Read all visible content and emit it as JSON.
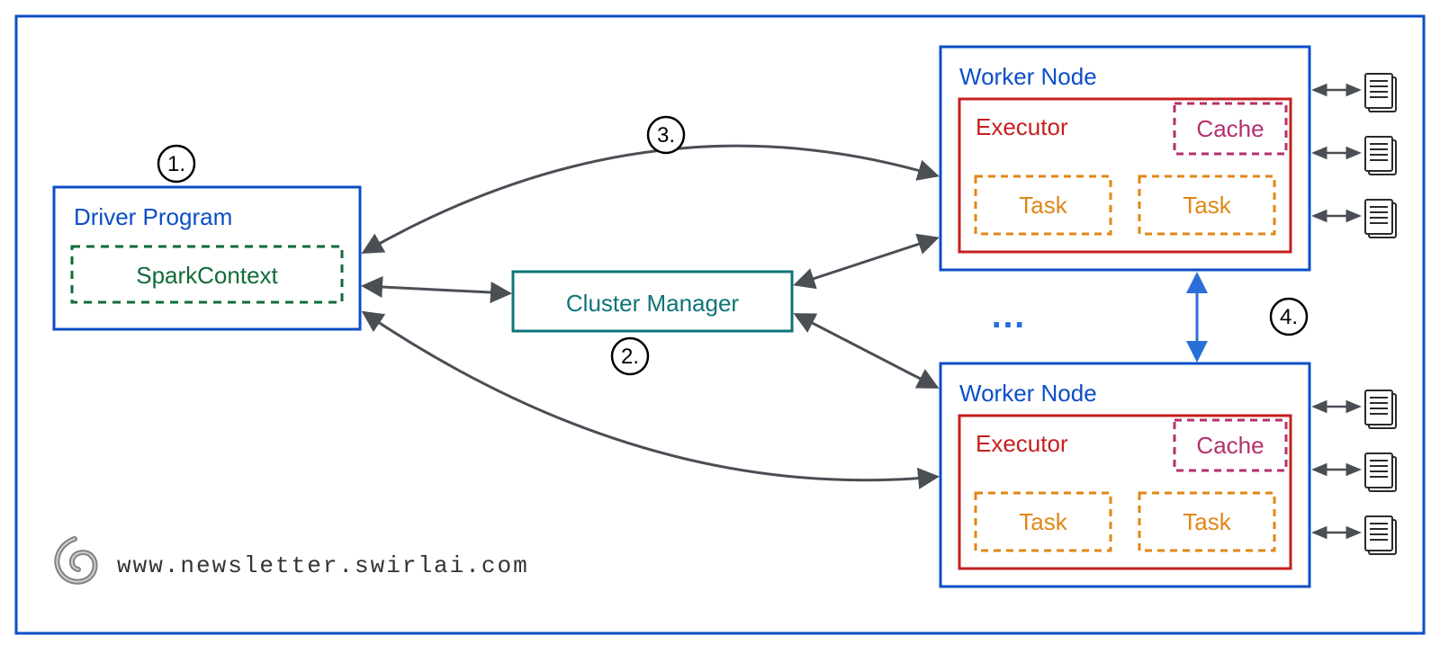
{
  "driver": {
    "title": "Driver Program",
    "context": "SparkContext"
  },
  "cluster": {
    "title": "Cluster Manager"
  },
  "worker1": {
    "title": "Worker Node",
    "executor": "Executor",
    "cache": "Cache",
    "task1": "Task",
    "task2": "Task"
  },
  "worker2": {
    "title": "Worker Node",
    "executor": "Executor",
    "cache": "Cache",
    "task1": "Task",
    "task2": "Task"
  },
  "ellipsis": "…",
  "steps": {
    "s1": "1.",
    "s2": "2.",
    "s3": "3.",
    "s4": "4."
  },
  "footer": "www.newsletter.swirlai.com",
  "colors": {
    "frame": "#0b4ec7",
    "driverBox": "#0b4ec7",
    "sparkCtx": "#116b3a",
    "cluster": "#0e7478",
    "workerBox": "#0b4ec7",
    "executor": "#c61f1f",
    "cache": "#b4306d",
    "task": "#e08716",
    "arrow": "#4a4f55",
    "accent": "#2a6fd8"
  }
}
